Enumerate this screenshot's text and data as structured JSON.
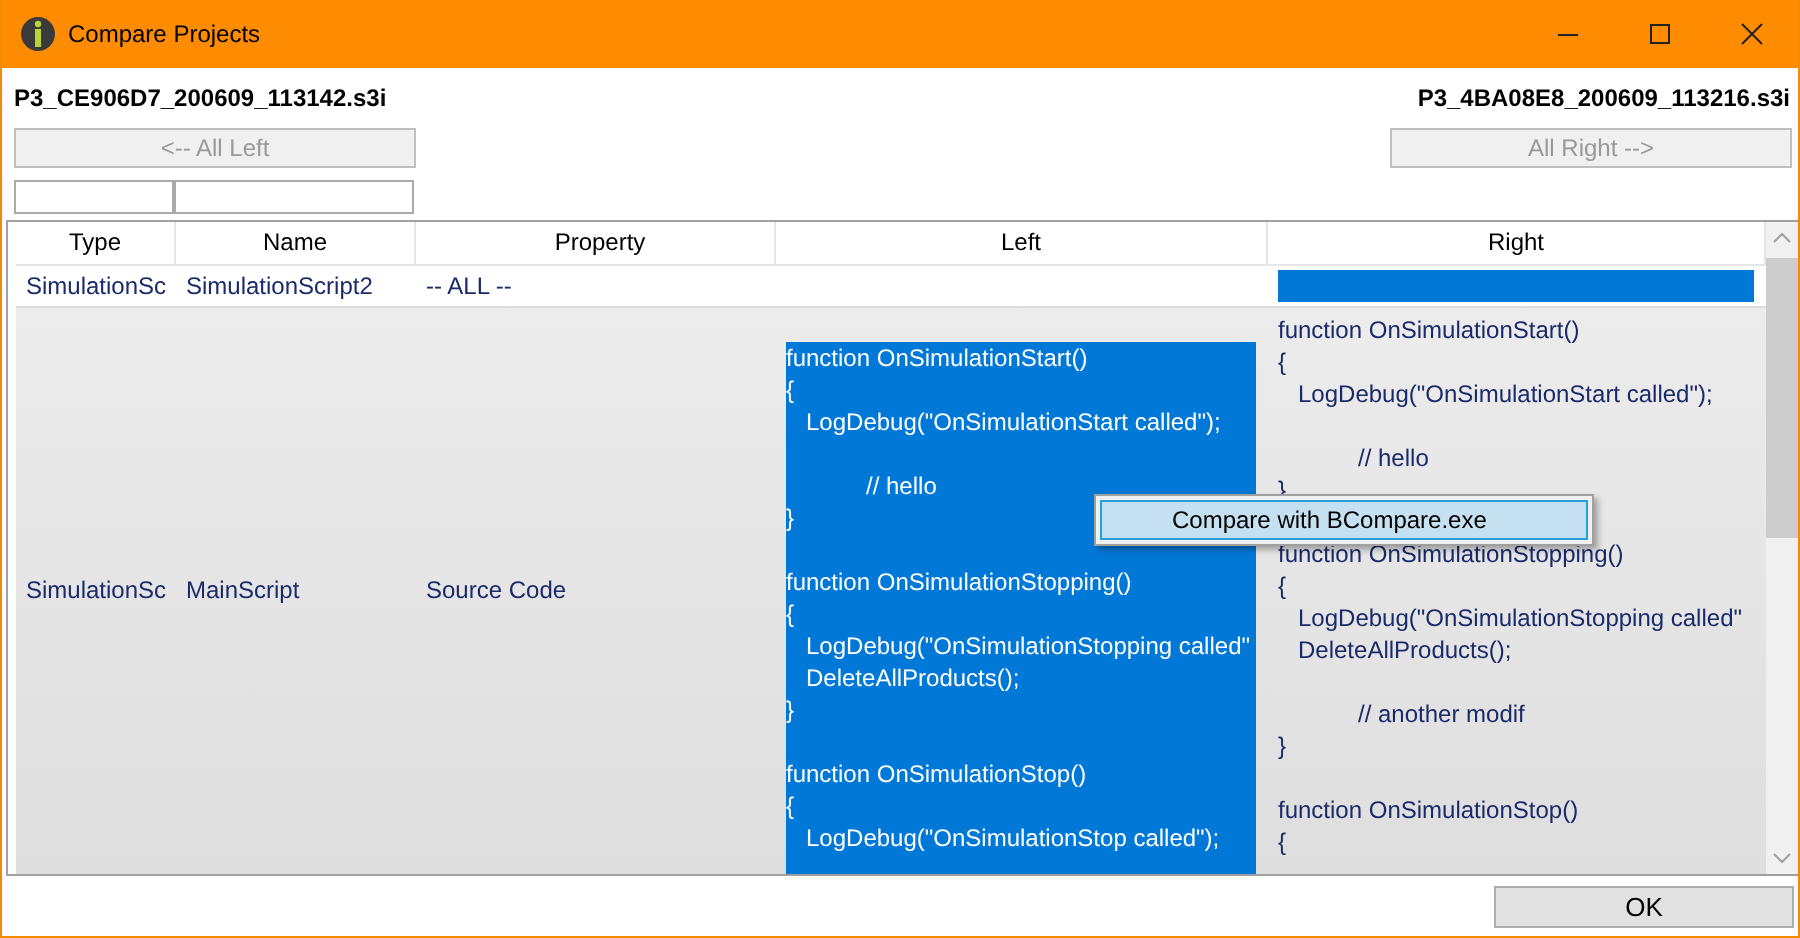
{
  "window": {
    "title": "Compare Projects"
  },
  "left_file": "P3_CE906D7_200609_113142.s3i",
  "right_file": "P3_4BA08E8_200609_113216.s3i",
  "all_left_button": {
    "label": "<-- All Left",
    "disabled": true
  },
  "all_right_button": {
    "label": "All Right -->",
    "disabled": true
  },
  "table": {
    "columns": [
      "Type",
      "Name",
      "Property",
      "Left",
      "Right"
    ],
    "rows": [
      {
        "type": "SimulationSc",
        "name": "SimulationScript2",
        "property": "-- ALL --",
        "left": {
          "selected": false
        },
        "right": {
          "selected": true
        }
      },
      {
        "type": "SimulationSc",
        "name": "MainScript",
        "property": "Source Code",
        "left": {
          "selected": true,
          "code": "function OnSimulationStart()\n{\n   LogDebug(\"OnSimulationStart called\");\n\n            // hello\n}\n\nfunction OnSimulationStopping()\n{\n   LogDebug(\"OnSimulationStopping called\"\n   DeleteAllProducts();\n}\n\nfunction OnSimulationStop()\n{\n   LogDebug(\"OnSimulationStop called\");"
        },
        "right": {
          "selected": false,
          "code": "function OnSimulationStart()\n{\n   LogDebug(\"OnSimulationStart called\");\n\n            // hello\n}\n\nfunction OnSimulationStopping()\n{\n   LogDebug(\"OnSimulationStopping called\"\n   DeleteAllProducts();\n\n            // another modif\n}\n\nfunction OnSimulationStop()\n{"
        }
      }
    ]
  },
  "context_menu": {
    "items": [
      {
        "label": "Compare with BCompare.exe",
        "selected": true
      }
    ]
  },
  "ok_button": {
    "label": "OK"
  }
}
